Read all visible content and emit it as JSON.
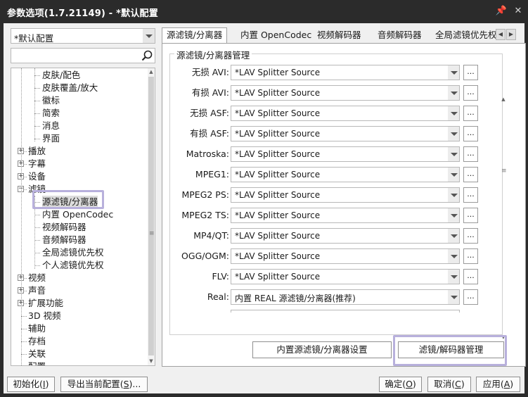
{
  "window": {
    "title": "参数选项(1.7.21149) - *默认配置",
    "pin_glyph": "📌",
    "close_glyph": "✕"
  },
  "profile": {
    "selected": "*默认配置"
  },
  "search": {
    "value": ""
  },
  "tree": {
    "items": [
      {
        "label": "皮肤/配色",
        "level": 2
      },
      {
        "label": "皮肤覆盖/放大",
        "level": 2
      },
      {
        "label": "徽标",
        "level": 2
      },
      {
        "label": "简索",
        "level": 2
      },
      {
        "label": "消息",
        "level": 2
      },
      {
        "label": "界面",
        "level": 2
      },
      {
        "label": "播放",
        "level": 1,
        "expander": "+"
      },
      {
        "label": "字幕",
        "level": 1,
        "expander": "+"
      },
      {
        "label": "设备",
        "level": 1,
        "expander": "+"
      },
      {
        "label": "滤镜",
        "level": 1,
        "expander": "−"
      },
      {
        "label": "源滤镜/分离器",
        "level": 2,
        "selected": true
      },
      {
        "label": "内置 OpenCodec",
        "level": 2
      },
      {
        "label": "视频解码器",
        "level": 2
      },
      {
        "label": "音频解码器",
        "level": 2
      },
      {
        "label": "全局滤镜优先权",
        "level": 2
      },
      {
        "label": "个人滤镜优先权",
        "level": 2
      },
      {
        "label": "视频",
        "level": 1,
        "expander": "+"
      },
      {
        "label": "声音",
        "level": 1,
        "expander": "+"
      },
      {
        "label": "扩展功能",
        "level": 1,
        "expander": "+"
      },
      {
        "label": "3D 视频",
        "level": 1
      },
      {
        "label": "辅助",
        "level": 1
      },
      {
        "label": "存档",
        "level": 1
      },
      {
        "label": "关联",
        "level": 1
      },
      {
        "label": "配置",
        "level": 1
      }
    ]
  },
  "tabs": [
    {
      "label": "源滤镜/分离器",
      "active": true
    },
    {
      "label": "内置 OpenCodec"
    },
    {
      "label": "视频解码器"
    },
    {
      "label": "音频解码器"
    },
    {
      "label": "全局滤镜优先权"
    }
  ],
  "tab_nav": {
    "prev": "◀",
    "next": "▶"
  },
  "group": {
    "title": "源滤镜/分离器管理",
    "rows": [
      {
        "label": "无损 AVI:",
        "value": "*LAV Splitter Source"
      },
      {
        "label": "有损 AVI:",
        "value": "*LAV Splitter Source"
      },
      {
        "label": "无损 ASF:",
        "value": "*LAV Splitter Source"
      },
      {
        "label": "有损 ASF:",
        "value": "*LAV Splitter Source"
      },
      {
        "label": "Matroska:",
        "value": "*LAV Splitter Source"
      },
      {
        "label": "MPEG1:",
        "value": "*LAV Splitter Source"
      },
      {
        "label": "MPEG2 PS:",
        "value": "*LAV Splitter Source"
      },
      {
        "label": "MPEG2 TS:",
        "value": "*LAV Splitter Source"
      },
      {
        "label": "MP4/QT:",
        "value": "*LAV Splitter Source"
      },
      {
        "label": "OGG/OGM:",
        "value": "*LAV Splitter Source"
      },
      {
        "label": "FLV:",
        "value": "*LAV Splitter Source"
      },
      {
        "label": "Real:",
        "value": "内置 REAL 源滤镜/分离器(推荐)"
      }
    ],
    "more_label": "..."
  },
  "buttons": {
    "builtin_source_settings": "内置源滤镜/分离器设置",
    "filter_decoder_manage": "滤镜/解码器管理",
    "init_prefix": "初始化(",
    "init_key": "I",
    "init_suffix": ")",
    "export_prefix": "导出当前配置(",
    "export_key": "S",
    "export_suffix": ")...",
    "ok_prefix": "确定(",
    "ok_key": "O",
    "ok_suffix": ")",
    "cancel_prefix": "取消(",
    "cancel_key": "C",
    "cancel_suffix": ")",
    "apply_prefix": "应用(",
    "apply_key": "A",
    "apply_suffix": ")"
  },
  "colors": {
    "highlight": "#b8b0dc",
    "titlebar": "#2b2b2b",
    "client": "#f0f0f0"
  }
}
